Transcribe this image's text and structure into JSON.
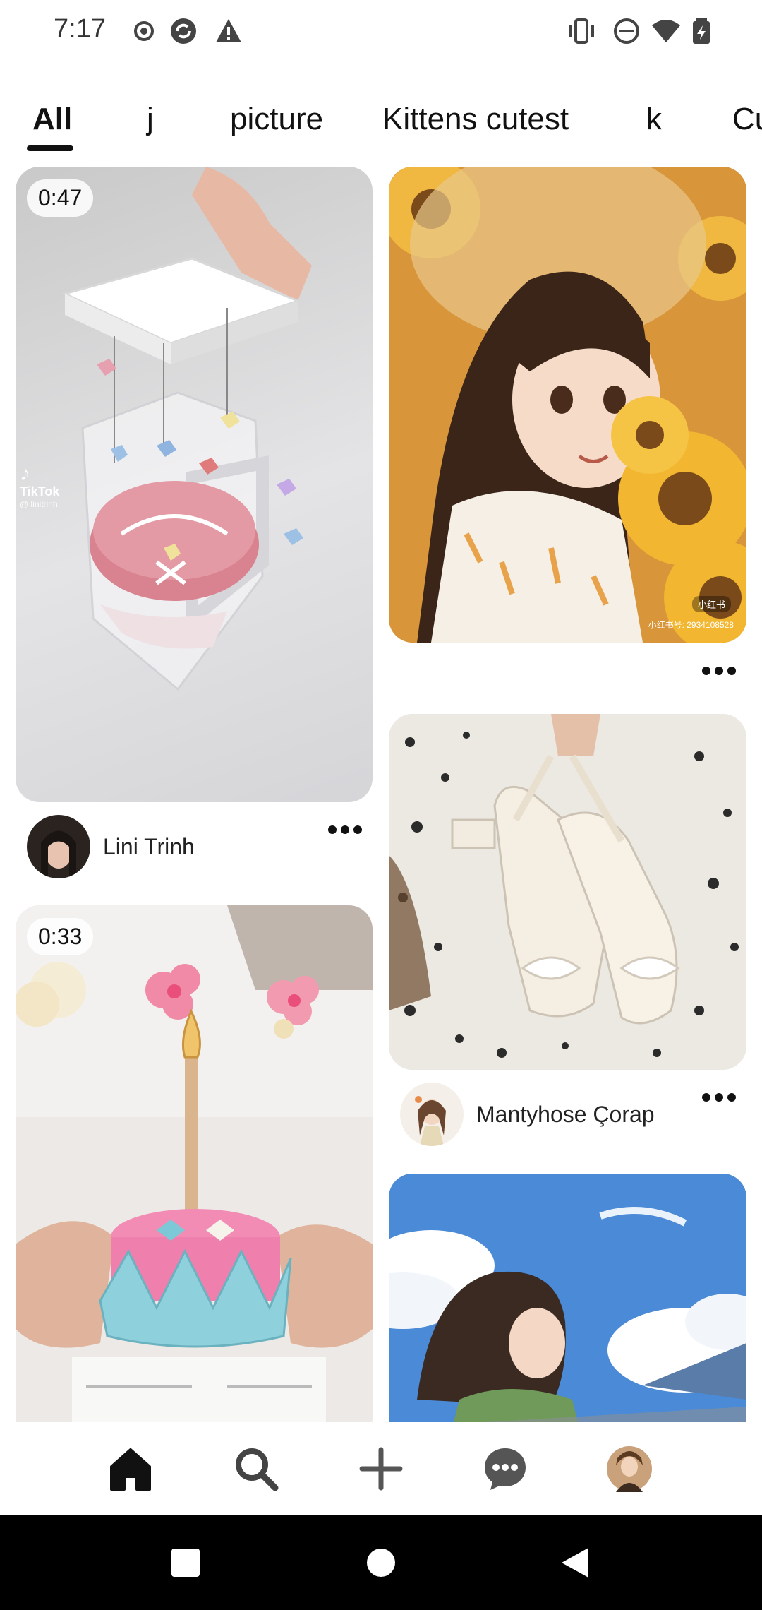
{
  "status_bar": {
    "time": "7:17",
    "left_icons": [
      "record-icon",
      "sync-icon",
      "warning-icon"
    ],
    "right_icons": [
      "vibrate-icon",
      "do-not-disturb-icon",
      "wifi-icon",
      "battery-icon"
    ]
  },
  "tabs": {
    "items": [
      "All",
      "j",
      "picture",
      "Kittens cutest",
      "k",
      "Cu"
    ],
    "selected": "All"
  },
  "pins": [
    {
      "duration": "0:47",
      "author": "Lini Trinh",
      "watermark": "TikTok",
      "watermark_handle": "@ linitrinh"
    },
    {
      "watermark": "小红书",
      "watermark_id": "小红书号: 2934108528"
    },
    {
      "author": "Mantyhose Çorap"
    },
    {
      "duration": "0:33"
    },
    {}
  ],
  "bottom_nav": [
    "home-icon",
    "search-icon",
    "create-icon",
    "messages-icon",
    "profile-avatar"
  ],
  "system_nav": [
    "recents-icon",
    "home-circle-icon",
    "back-icon"
  ],
  "colors": {
    "accent": "#111111",
    "system_nav_bg": "#000000"
  }
}
